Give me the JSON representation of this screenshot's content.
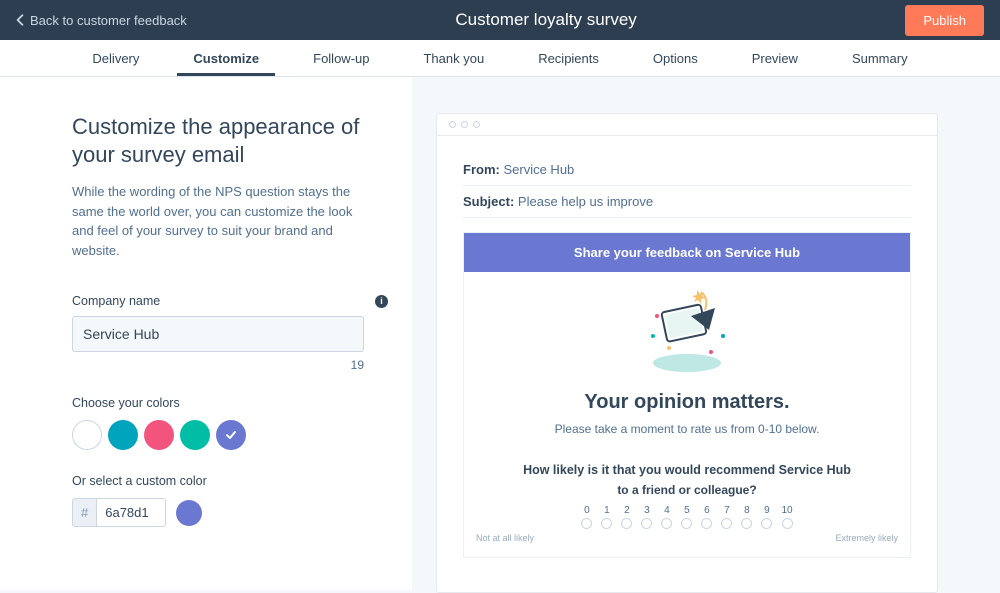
{
  "header": {
    "back_label": "Back to customer feedback",
    "title": "Customer loyalty survey",
    "publish_label": "Publish"
  },
  "tabs": {
    "items": [
      {
        "label": "Delivery"
      },
      {
        "label": "Customize"
      },
      {
        "label": "Follow-up"
      },
      {
        "label": "Thank you"
      },
      {
        "label": "Recipients"
      },
      {
        "label": "Options"
      },
      {
        "label": "Preview"
      },
      {
        "label": "Summary"
      }
    ],
    "active_index": 1
  },
  "panel": {
    "title": "Customize the appearance of your survey email",
    "description": "While the wording of the NPS question stays the same the world over, you can customize the look and feel of your survey to suit your brand and website.",
    "company_label": "Company name",
    "company_value": "Service Hub",
    "company_counter": "19",
    "colors_label": "Choose your colors",
    "color_swatches": [
      "white",
      "teal",
      "pink",
      "green",
      "purple"
    ],
    "selected_color_index": 4,
    "custom_color_label": "Or select a custom color",
    "hex_prefix": "#",
    "hex_value": "6a78d1"
  },
  "preview": {
    "from_label": "From:",
    "from_value": "Service Hub",
    "subject_label": "Subject:",
    "subject_value": "Please help us improve",
    "banner": "Share your feedback on Service Hub",
    "headline": "Your opinion matters.",
    "subtext": "Please take a moment to rate us from 0-10 below.",
    "question_line1": "How likely is it that you would recommend Service Hub",
    "question_line2": "to a friend or colleague?",
    "scale": [
      "0",
      "1",
      "2",
      "3",
      "4",
      "5",
      "6",
      "7",
      "8",
      "9",
      "10"
    ],
    "anchor_low": "Not at all likely",
    "anchor_high": "Extremely likely"
  },
  "colors": {
    "accent": "#6a78d1"
  }
}
